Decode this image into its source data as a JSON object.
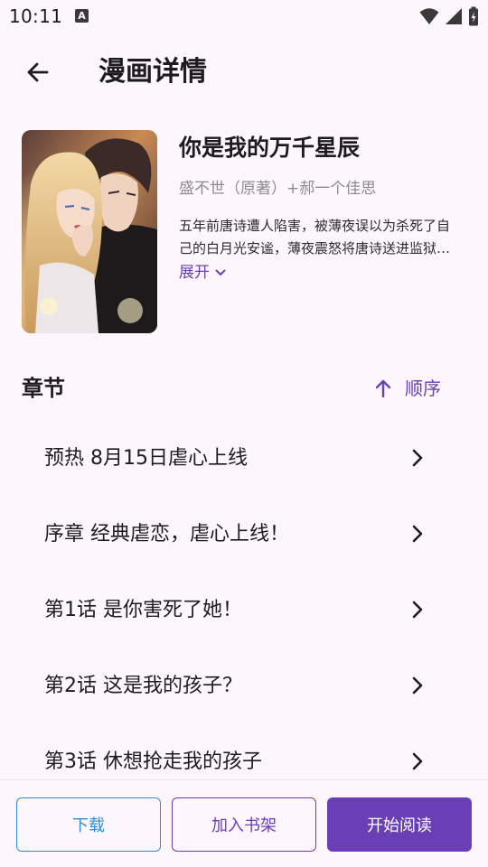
{
  "status_bar": {
    "time": "10:11",
    "notification_icon": "a-icon"
  },
  "app_bar": {
    "title": "漫画详情",
    "back_icon": "arrow-left-icon"
  },
  "comic": {
    "title": "你是我的万千星辰",
    "author": "盛不世（原著）+郝一个佳思",
    "description": "五年前唐诗遭人陷害，被薄夜误以为杀死了自己的白月光安谧，薄夜震怒将唐诗送进监狱，五年后唐诗出狱，他们之间的纠葛才刚刚开始……",
    "expand_label": "展开"
  },
  "chapters": {
    "heading": "章节",
    "sort_label": "顺序",
    "items": [
      {
        "title": "预热 8月15日虐心上线"
      },
      {
        "title": "序章 经典虐恋，虐心上线！"
      },
      {
        "title": "第1话 是你害死了她！"
      },
      {
        "title": "第2话 这是我的孩子？"
      },
      {
        "title": "第3话 休想抢走我的孩子"
      }
    ]
  },
  "bottom_bar": {
    "download_label": "下载",
    "add_to_shelf_label": "加入书架",
    "start_reading_label": "开始阅读"
  },
  "colors": {
    "accent": "#6A3FB5",
    "download": "#2E8FD8",
    "background": "#FDF7FD"
  }
}
